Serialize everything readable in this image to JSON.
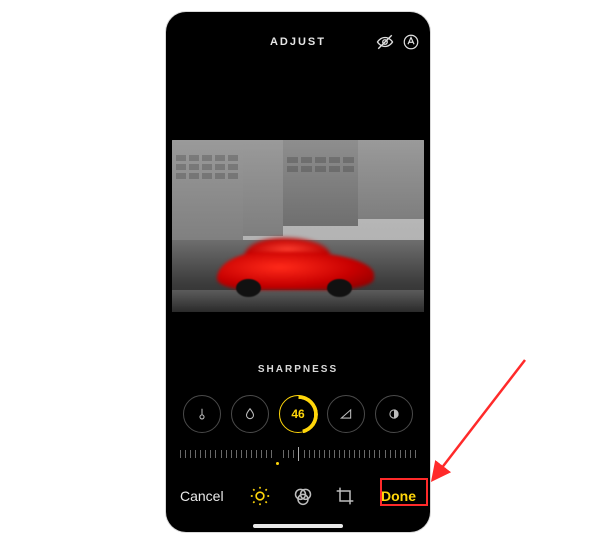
{
  "header": {
    "title": "ADJUST",
    "preview_icon": "eye-off-icon",
    "markup_icon": "markup-icon"
  },
  "current_adjustment": {
    "label": "SHARPNESS",
    "value": "46"
  },
  "dials": [
    {
      "name": "exposure",
      "icon": "thermometer-icon"
    },
    {
      "name": "brilliance",
      "icon": "drop-icon"
    },
    {
      "name": "sharpness",
      "value": "46",
      "selected": true
    },
    {
      "name": "definition",
      "icon": "triangle-icon"
    },
    {
      "name": "vignette",
      "icon": "half-circle-icon"
    }
  ],
  "bottom": {
    "cancel": "Cancel",
    "done": "Done",
    "mode_adjust": "adjust-icon",
    "mode_filters": "filters-icon",
    "mode_crop": "crop-icon"
  },
  "annotation": {
    "target": "done-button"
  },
  "colors": {
    "accent": "#ffd60a",
    "annotation": "#ff2a2a"
  }
}
